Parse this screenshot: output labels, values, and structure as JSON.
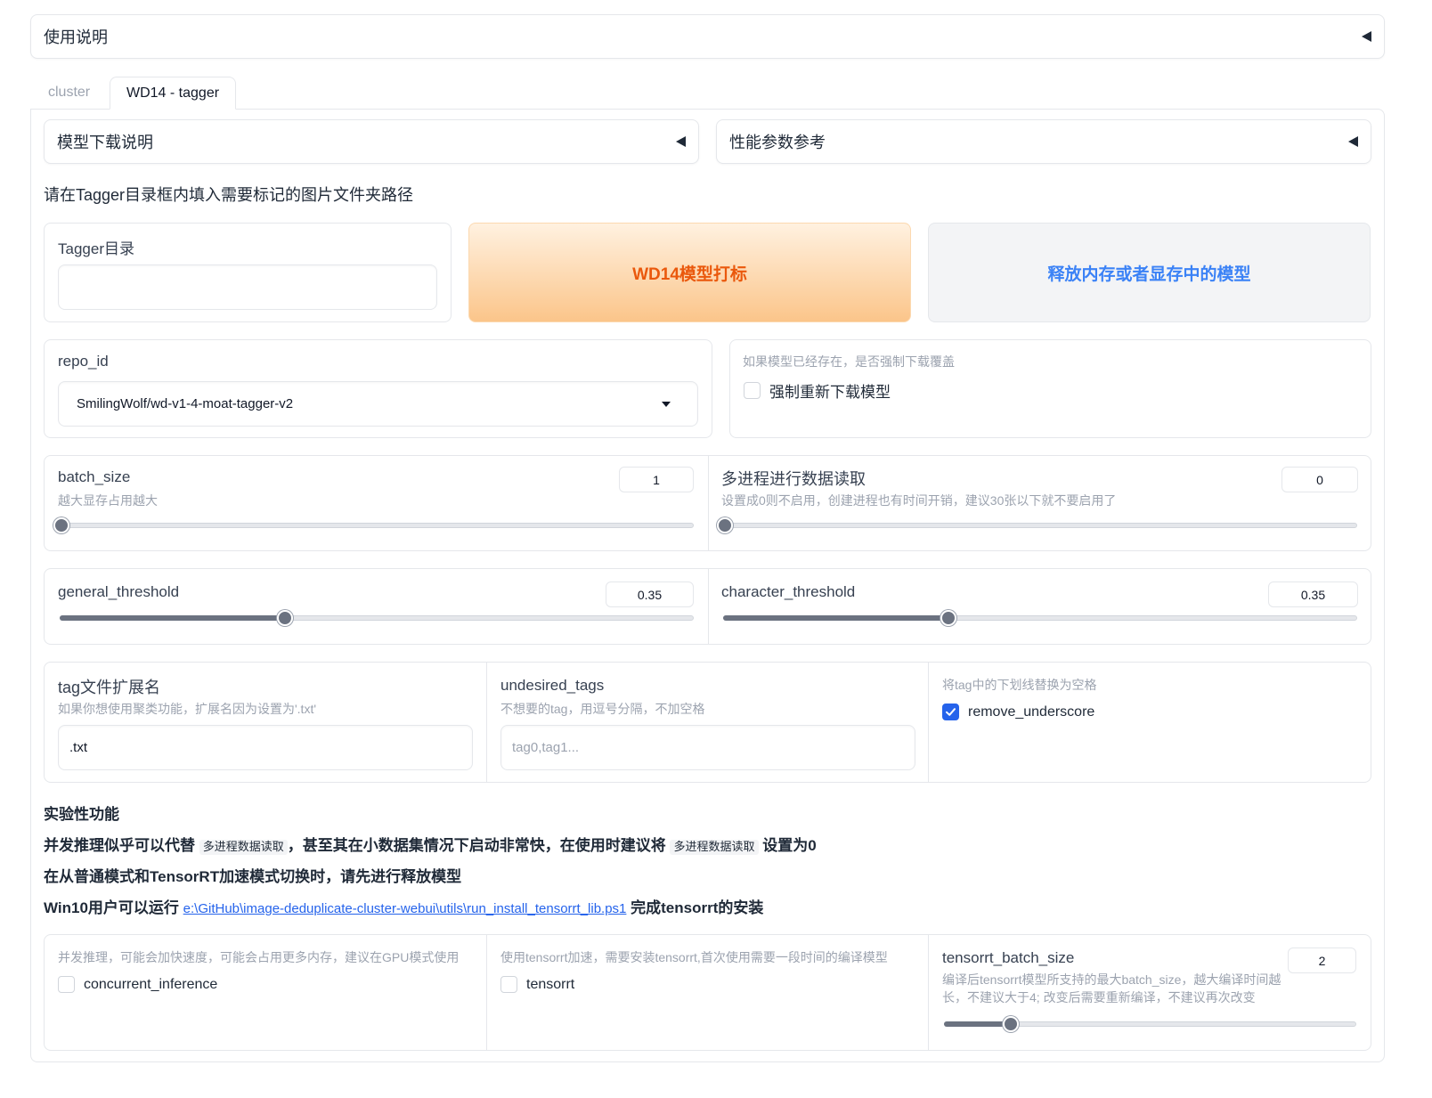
{
  "top_accordion": {
    "label": "使用说明"
  },
  "tabs": [
    {
      "label": "cluster"
    },
    {
      "label": "WD14 - tagger"
    }
  ],
  "accordions": {
    "model_download": "模型下载说明",
    "perf_reference": "性能参数参考"
  },
  "instruction": "请在Tagger目录框内填入需要标记的图片文件夹路径",
  "tagger_dir": {
    "label": "Tagger目录",
    "value": ""
  },
  "buttons": {
    "tag": "WD14模型打标",
    "release": "释放内存或者显存中的模型"
  },
  "repo_id": {
    "label": "repo_id",
    "value": "SmilingWolf/wd-v1-4-moat-tagger-v2"
  },
  "force_download": {
    "info": "如果模型已经存在，是否强制下载覆盖",
    "label": "强制重新下载模型",
    "checked": false
  },
  "batch_size": {
    "label": "batch_size",
    "info": "越大显存占用越大",
    "value": "1",
    "fraction": 0.0
  },
  "workers": {
    "label": "多进程进行数据读取",
    "info": "设置成0则不启用，创建进程也有时间开销，建议30张以下就不要启用了",
    "value": "0",
    "fraction": 0.0
  },
  "general_threshold": {
    "label": "general_threshold",
    "value": "0.35",
    "fraction": 0.35
  },
  "character_threshold": {
    "label": "character_threshold",
    "value": "0.35",
    "fraction": 0.35
  },
  "tag_ext": {
    "label": "tag文件扩展名",
    "info": "如果你想使用聚类功能，扩展名因为设置为'.txt'",
    "value": ".txt"
  },
  "undesired_tags": {
    "label": "undesired_tags",
    "info": "不想要的tag，用逗号分隔，不加空格",
    "placeholder": "tag0,tag1..."
  },
  "remove_underscore": {
    "info": "将tag中的下划线替换为空格",
    "label": "remove_underscore",
    "checked": true
  },
  "experimental": {
    "title": "实验性功能",
    "line1_a": "并发推理似乎可以代替",
    "line1_code1": "多进程数据读取",
    "line1_b": "，甚至其在小数据集情况下启动非常快，在使用时建议将",
    "line1_code2": "多进程数据读取",
    "line1_c": "设置为0",
    "line2": "在从普通模式和TensorRT加速模式切换时，请先进行释放模型",
    "line3_a": "Win10用户可以运行",
    "line3_link": "e:\\GitHub\\image-deduplicate-cluster-webui\\utils\\run_install_tensorrt_lib.ps1",
    "line3_b": "完成tensorrt的安装"
  },
  "concurrent_inference": {
    "info": "并发推理，可能会加快速度，可能会占用更多内存，建议在GPU模式使用",
    "label": "concurrent_inference",
    "checked": false
  },
  "tensorrt": {
    "info": "使用tensorrt加速，需要安装tensorrt,首次使用需要一段时间的编译模型",
    "label": "tensorrt",
    "checked": false
  },
  "tensorrt_batch_size": {
    "label": "tensorrt_batch_size",
    "info": "编译后tensorrt模型所支持的最大batch_size，越大编译时间越长，不建议大于4; 改变后需要重新编译，不建议再次改变",
    "value": "2",
    "fraction": 0.14
  },
  "colors": {
    "accent_orange": "#ea580c",
    "accent_blue": "#3b82f6",
    "checkbox_blue": "#2563eb"
  }
}
